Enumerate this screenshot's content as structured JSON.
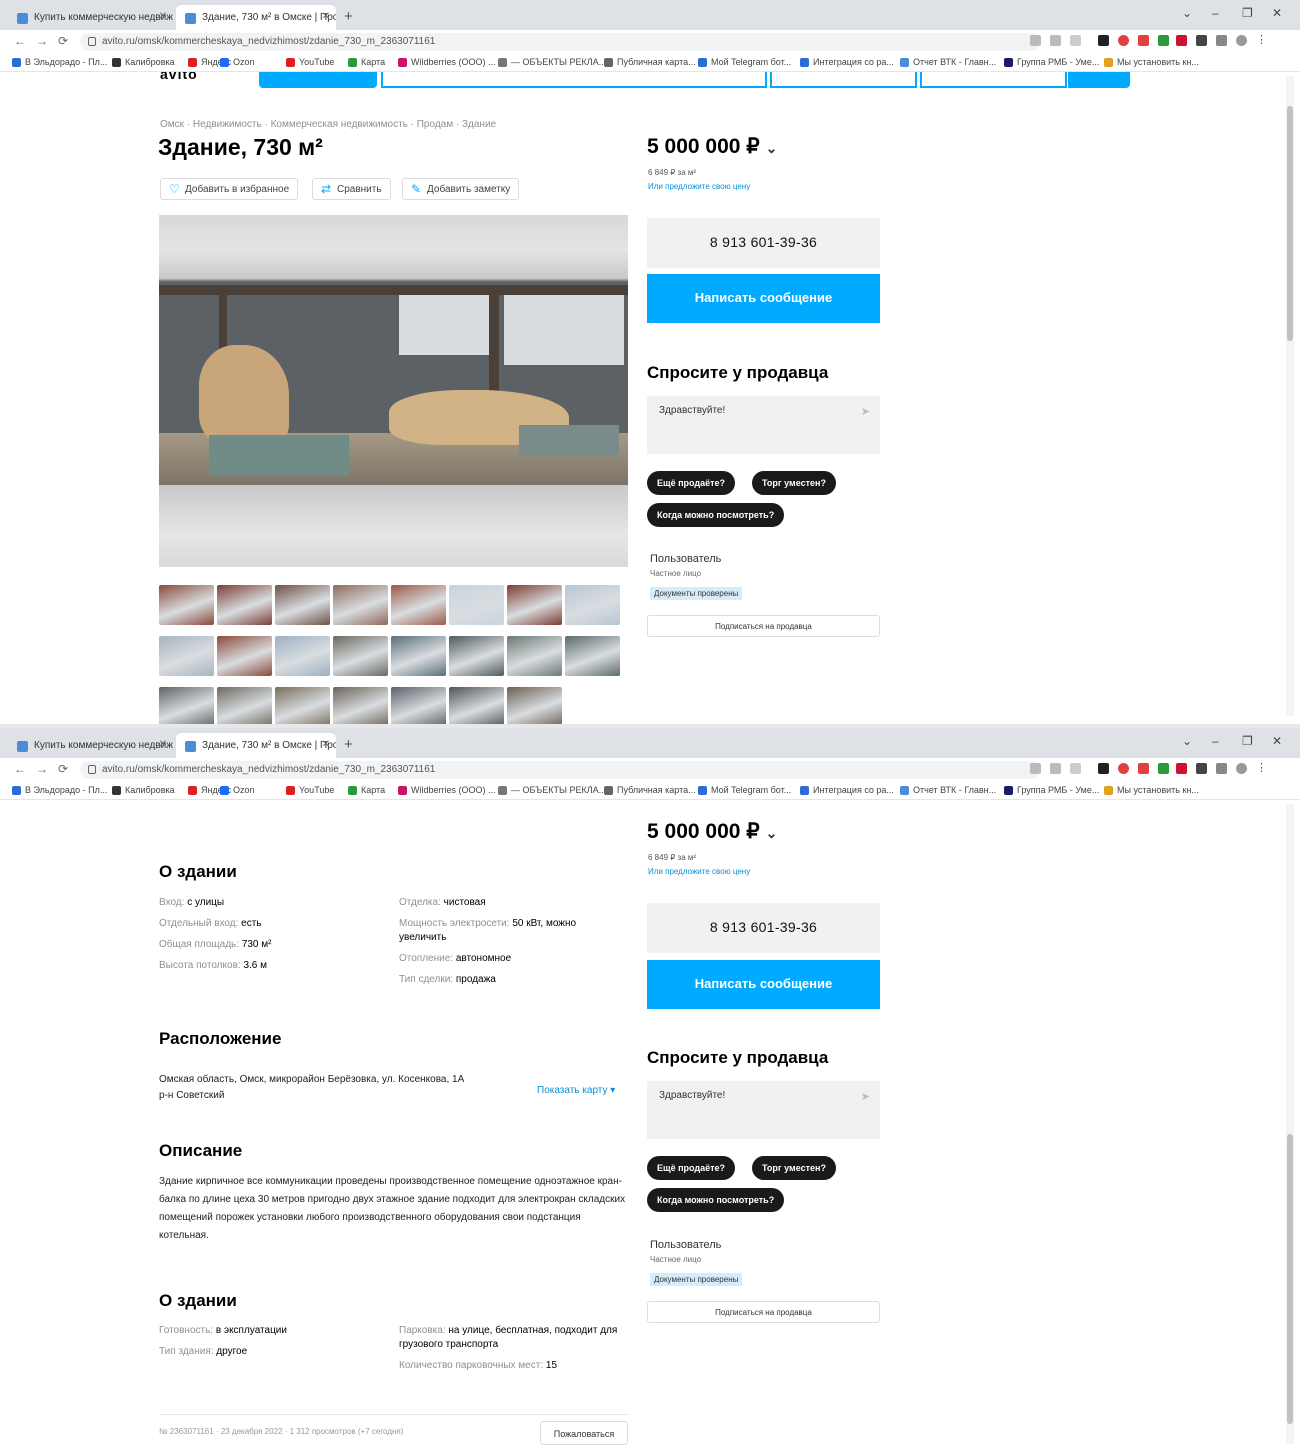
{
  "browser": {
    "tabs": [
      {
        "title": "Купить коммерческую недвижи..."
      },
      {
        "title": "Здание, 730 м² в Омске | Прод..."
      }
    ],
    "url": "avito.ru/omsk/kommercheskaya_nedvizhimost/zdanie_730_m_2363071161",
    "bookmarks": [
      {
        "label": "В Эльдорадо - Пл...",
        "color": "#2b6cd6"
      },
      {
        "label": "Калибровка",
        "color": "#333"
      },
      {
        "label": "Яндекс",
        "color": "#e02020"
      },
      {
        "label": "Ozon",
        "color": "#1a6bff"
      },
      {
        "label": "YouTube",
        "color": "#e02020"
      },
      {
        "label": "Карта",
        "color": "#2a9b3a"
      },
      {
        "label": "Wildberries (ООО) ...",
        "color": "#cc1166"
      },
      {
        "label": "— ОБЪЕКТЫ РЕКЛА...",
        "color": "#777"
      },
      {
        "label": "Публичная карта...",
        "color": "#666"
      },
      {
        "label": "Мой Telegram бот...",
        "color": "#2b6cd6"
      },
      {
        "label": "Интеграция со ра...",
        "color": "#2b6cd6"
      },
      {
        "label": "Отчет ВТК - Главн...",
        "color": "#4a8cd8"
      },
      {
        "label": "Группа РМБ - Уме...",
        "color": "#1a1a6b"
      },
      {
        "label": "Мы установить кн...",
        "color": "#e0a020"
      }
    ]
  },
  "listing": {
    "breadcrumbs": "Омск · Недвижимость · Коммерческая недвижимость · Продам · Здание",
    "title": "Здание, 730 м²",
    "actions": {
      "favorite": "Добавить в избранное",
      "compare": "Сравнить",
      "note": "Добавить заметку"
    },
    "price": "5 000 000 ₽",
    "price_per_m2": "6 849 ₽ за м²",
    "offer_link": "Или предложите свою цену",
    "phone": "8 913 601-39-36",
    "write_button": "Написать сообщение",
    "ask": {
      "title": "Спросите у продавца",
      "placeholder": "Здравствуйте!",
      "chips": [
        "Ещё продаёте?",
        "Торг уместен?",
        "Когда можно посмотреть?"
      ]
    },
    "seller": {
      "name": "Пользователь",
      "type": "Частное лицо",
      "badge": "Документы проверены",
      "subscribe": "Подписаться на продавца"
    }
  },
  "about_building": {
    "title": "О здании",
    "left": [
      {
        "k": "Вход:",
        "v": "с улицы"
      },
      {
        "k": "Отдельный вход:",
        "v": "есть"
      },
      {
        "k": "Общая площадь:",
        "v": "730 м²"
      },
      {
        "k": "Высота потолков:",
        "v": "3.6 м"
      }
    ],
    "right": [
      {
        "k": "Отделка:",
        "v": "чистовая"
      },
      {
        "k": "Мощность электросети:",
        "v": "50 кВт, можно увеличить"
      },
      {
        "k": "Отопление:",
        "v": "автономное"
      },
      {
        "k": "Тип сделки:",
        "v": "продажа"
      }
    ]
  },
  "location": {
    "title": "Расположение",
    "address": "Омская область, Омск, микрорайон Берёзовка, ул. Косенкова, 1А",
    "district": "р-н Советский",
    "show_map": "Показать карту ▾"
  },
  "description": {
    "title": "Описание",
    "text": "Здание кирпичное все коммуникации проведены производственное помещение одноэтажное кран-балка по длине цеха 30 метров пригодно двух этажное здание подходит для электрокран складских помещений порожек установки любого производственного оборудования свои подстанция котельная."
  },
  "about_building2": {
    "title": "О здании",
    "left": [
      {
        "k": "Готовность:",
        "v": "в эксплуатации"
      },
      {
        "k": "Тип здания:",
        "v": "другое"
      }
    ],
    "right": [
      {
        "k": "Парковка:",
        "v": "на улице, бесплатная, подходит для грузового транспорта"
      },
      {
        "k": "Количество парковочных мест:",
        "v": "15"
      }
    ]
  },
  "footer": {
    "meta": "№ 2363071161 · 23 декабря 2022 · 1 312 просмотров (+7 сегодня)",
    "complain": "Пожаловаться"
  }
}
